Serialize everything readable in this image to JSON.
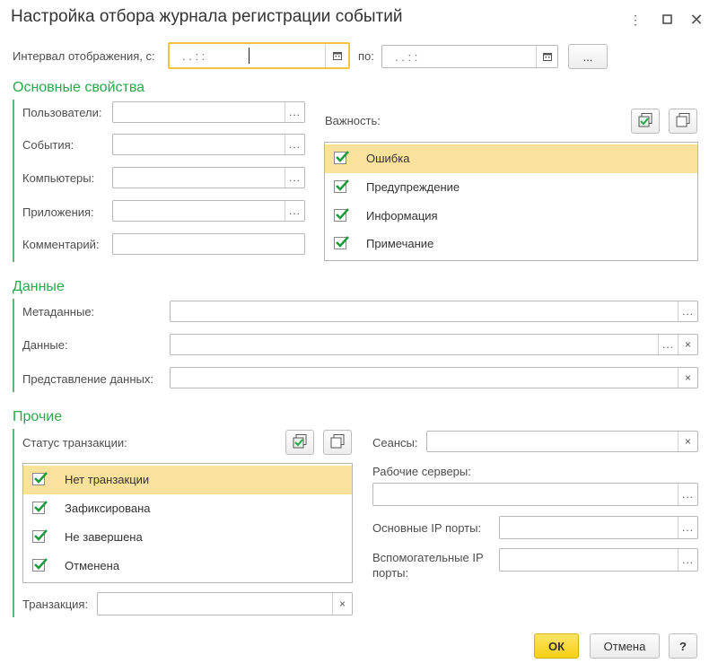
{
  "window": {
    "title": "Настройка отбора журнала регистрации событий",
    "menu_icon": "more-vertical-icon",
    "maximize_icon": "maximize-icon",
    "close_icon": "close-icon"
  },
  "interval": {
    "label": "Интервал отображения, с:",
    "from_value": ". .   : :",
    "to_label": "по:",
    "to_value": ". .   : :",
    "more_button": "..."
  },
  "main_props": {
    "title": "Основные свойства",
    "users_label": "Пользователи:",
    "events_label": "События:",
    "computers_label": "Компьютеры:",
    "apps_label": "Приложения:",
    "comment_label": "Комментарий:",
    "select_button": "..."
  },
  "importance": {
    "label": "Важность:",
    "items": [
      {
        "label": "Ошибка",
        "checked": true,
        "selected": true
      },
      {
        "label": "Предупреждение",
        "checked": true,
        "selected": false
      },
      {
        "label": "Информация",
        "checked": true,
        "selected": false
      },
      {
        "label": "Примечание",
        "checked": true,
        "selected": false
      }
    ]
  },
  "data_section": {
    "title": "Данные",
    "metadata_label": "Метаданные:",
    "data_label": "Данные:",
    "presentation_label": "Представление данных:",
    "clear_button": "×"
  },
  "other": {
    "title": "Прочие",
    "tx_status_label": "Статус транзакции:",
    "tx_items": [
      {
        "label": "Нет транзакции",
        "checked": true,
        "selected": true
      },
      {
        "label": "Зафиксирована",
        "checked": true,
        "selected": false
      },
      {
        "label": "Не завершена",
        "checked": true,
        "selected": false
      },
      {
        "label": "Отменена",
        "checked": true,
        "selected": false
      }
    ],
    "transaction_label": "Транзакция:",
    "sessions_label": "Сеансы:",
    "work_servers_label": "Рабочие серверы:",
    "main_ports_label": "Основные IP порты:",
    "aux_ports_label_line1": "Вспомогательные IP",
    "aux_ports_label_line2": "порты:"
  },
  "footer": {
    "ok": "ОК",
    "cancel": "Отмена",
    "help": "?"
  },
  "colors": {
    "accent_green": "#2aa84a",
    "selection_yellow": "#fbe29c",
    "focus_border": "#f5c342",
    "ok_button": "#f6cf12"
  }
}
